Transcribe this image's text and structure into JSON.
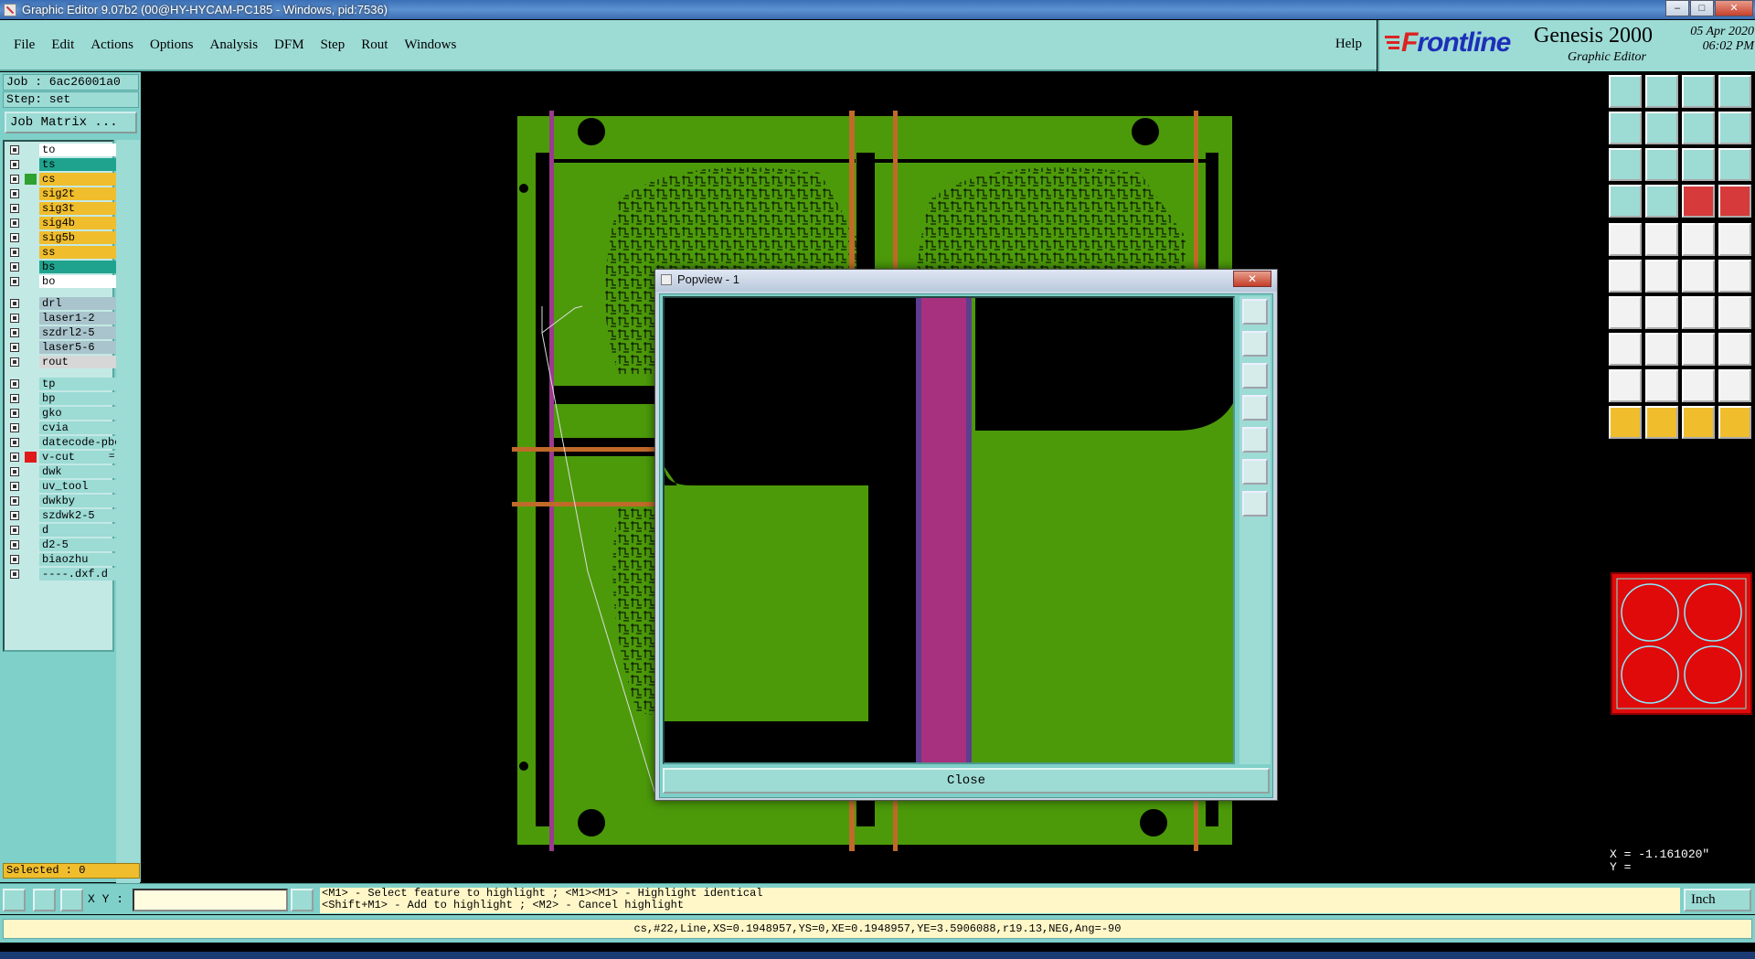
{
  "window": {
    "title": "Graphic Editor 9.07b2 (00@HY-HYCAM-PC185 - Windows, pid:7536)"
  },
  "menu": [
    "File",
    "Edit",
    "Actions",
    "Options",
    "Analysis",
    "DFM",
    "Step",
    "Rout",
    "Windows"
  ],
  "help_label": "Help",
  "brand": {
    "logo_front": "F",
    "logo_rest": "rontline",
    "product": "Genesis 2000",
    "subtitle": "Graphic Editor",
    "date": "05 Apr 2020",
    "time": "06:02 PM"
  },
  "job": {
    "job": "Job : 6ac26001a0",
    "step": "Step: set",
    "matrix_label": "Job Matrix ..."
  },
  "layers": [
    {
      "name": "to",
      "color": "#ffffff"
    },
    {
      "name": "ts",
      "color": "#1fa38e"
    },
    {
      "name": "cs",
      "color": "#f0bd2d",
      "marker": "#2ea12e"
    },
    {
      "name": "sig2t",
      "color": "#f0bd2d"
    },
    {
      "name": "sig3t",
      "color": "#f0bd2d"
    },
    {
      "name": "sig4b",
      "color": "#f0bd2d"
    },
    {
      "name": "sig5b",
      "color": "#f0bd2d"
    },
    {
      "name": "ss",
      "color": "#f0bd2d"
    },
    {
      "name": "bs",
      "color": "#1fa38e"
    },
    {
      "name": "bo",
      "color": "#ffffff"
    },
    {
      "name": "drl",
      "color": "#a9c4cc"
    },
    {
      "name": "laser1-2",
      "color": "#a9c4cc"
    },
    {
      "name": "szdrl2-5",
      "color": "#a9c4cc"
    },
    {
      "name": "laser5-6",
      "color": "#a9c4cc"
    },
    {
      "name": "rout",
      "color": "#d7d7d7"
    },
    {
      "name": "tp",
      "color": "#9ddbd5"
    },
    {
      "name": "bp",
      "color": "#9ddbd5"
    },
    {
      "name": "gko",
      "color": "#9ddbd5"
    },
    {
      "name": "cvia",
      "color": "#9ddbd5"
    },
    {
      "name": "datecode-pbc",
      "color": "#9ddbd5"
    },
    {
      "name": "v-cut",
      "color": "#9ddbd5",
      "marker": "#e01a1a",
      "suffix": "="
    },
    {
      "name": "dwk",
      "color": "#9ddbd5"
    },
    {
      "name": "uv_tool",
      "color": "#9ddbd5"
    },
    {
      "name": "dwkby",
      "color": "#9ddbd5"
    },
    {
      "name": "szdwk2-5",
      "color": "#9ddbd5"
    },
    {
      "name": "d",
      "color": "#9ddbd5"
    },
    {
      "name": "d2-5",
      "color": "#9ddbd5"
    },
    {
      "name": "biaozhu",
      "color": "#9ddbd5"
    },
    {
      "name": "----.dxf.d",
      "color": "#9ddbd5"
    }
  ],
  "selected": "Selected : 0",
  "popview": {
    "title": "Popview - 1",
    "close_label": "Close"
  },
  "coords": {
    "x": "X = -1.161020\"",
    "y": "Y ="
  },
  "xy_label": "X Y :",
  "hint": {
    "line1": "<M1> - Select feature to highlight ; <M1><M1> - Highlight identical",
    "line2": "<Shift+M1> - Add to highlight ; <M2> - Cancel highlight"
  },
  "unit": "Inch",
  "status": "cs,#22,Line,XS=0.1948957,YS=0,XE=0.1948957,YE=3.5906088,r19.13,NEG,Ang=-90",
  "colors": {
    "board": "#4c9a0a",
    "vcut": "#9b3a8f",
    "panel": "#9ddbd5"
  }
}
